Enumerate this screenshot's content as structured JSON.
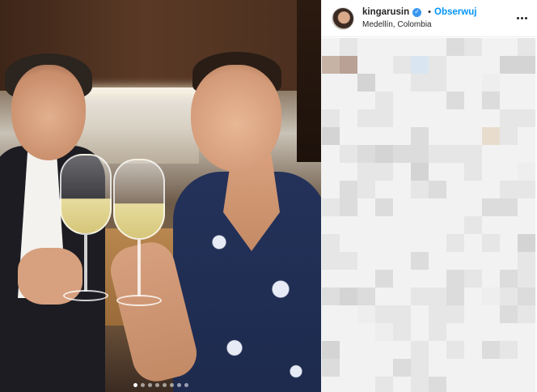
{
  "post": {
    "username": "kingarusin",
    "verified": true,
    "follow_label": "Obserwuj",
    "separator": "•",
    "location": "Medellín, Colombia",
    "more_icon": "more-horizontal-icon",
    "verified_icon": "verified-badge-icon",
    "carousel": {
      "total": 8,
      "active": 1
    }
  },
  "colors": {
    "follow_blue": "#0095f6",
    "verified_blue": "#3897f0",
    "text_dark": "#262626"
  }
}
